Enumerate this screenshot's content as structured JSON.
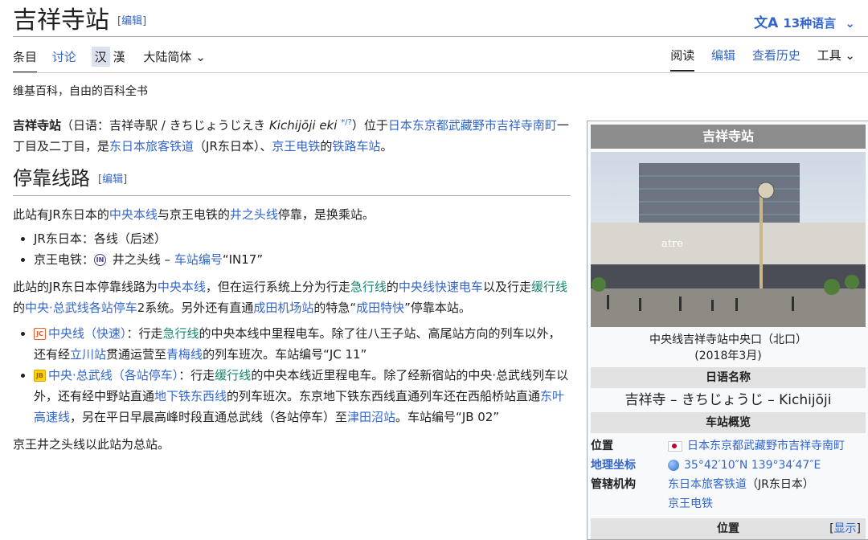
{
  "page": {
    "title": "吉祥寺站",
    "edit_label": "编辑",
    "languages_label": "13种语言",
    "tagline": "维基百科，自由的百科全书"
  },
  "tabs": {
    "left": [
      "条目",
      "讨论"
    ],
    "variants": [
      "汉",
      "漢"
    ],
    "variant_dropdown": "大陆简体",
    "right": [
      "阅读",
      "编辑",
      "查看历史",
      "工具"
    ]
  },
  "intro": {
    "lead_bold": "吉祥寺站",
    "lead_text1": "（日语：吉祥寺駅 / きちじょうじえき",
    "romaji": "Kichijōji eki",
    "audio_marks": "*/?",
    "lead_text2": "）位于",
    "loc_link": "日本东京都武藏野市吉祥寺南町",
    "lead_text3": "一丁目及二丁目，是",
    "jr_link": "东日本旅客铁道",
    "lead_text4": "（JR东日本）、",
    "keio_link": "京王电铁",
    "lead_text5": "的",
    "station_link": "铁路车站",
    "lead_text6": "。"
  },
  "section": {
    "heading": "停靠线路",
    "edit_label": "编辑",
    "p1": {
      "t1": "此站有JR东日本的",
      "l1": "中央本线",
      "t2": "与京王电铁的",
      "l2": "井之头线",
      "t3": "停靠，是换乘站。"
    },
    "bullets1": [
      {
        "text": "JR东日本：各线（后述）"
      },
      {
        "t1": "京王电铁：",
        "badge": "IN",
        "t2": " 井之头线 – ",
        "link": "车站编号",
        "t3": "“IN17”"
      }
    ],
    "p2": {
      "t1": "此站的JR东日本停靠线路为",
      "l1": "中央本线",
      "t2": "，但在运行系统上分为行走",
      "l2": "急行线",
      "t3": "的",
      "l3": "中央线快速电车",
      "t4": "以及行走",
      "l4": "缓行线",
      "t5": "的",
      "l5": "中央·总武线各站停车",
      "t6": "2系统。另外还有直通",
      "l6": "成田机场站",
      "t7": "的特急“",
      "l7": "成田特快",
      "t8": "”停靠本站。"
    },
    "bullets2": [
      {
        "badge": "JC",
        "name": "中央线（快速）",
        "t1": "：行走",
        "l1": "急行线",
        "t2": "的中央本线中里程电车。除了往八王子站、高尾站方向的列车以外，还有经",
        "l2": "立川站",
        "t3": "贯通运营至",
        "l3": "青梅线",
        "t4": "的列车班次。车站编号“JC 11”"
      },
      {
        "badge": "JB",
        "name": "中央·总武线（各站停车）",
        "t1": "：行走",
        "l1": "缓行线",
        "t2": "的中央本线近里程电车。除了经新宿站的中央·总武线列车以外，还有经中野站直通",
        "l2": "地下铁东西线",
        "t3": "的列车班次。东京地下铁东西线直通列车还在西船桥站直通",
        "l3": "东叶高速线",
        "t4": "，另在平日早晨高峰时段直通总武线（各站停车）至",
        "l4": "津田沼站",
        "t5": "。车站编号“JB 02”"
      }
    ],
    "p3": "京王井之头线以此站为总站。"
  },
  "infobox": {
    "title": "吉祥寺站",
    "photo_sign": "atre",
    "caption_line1": "中央线吉祥寺站中央口（北口）",
    "caption_line2": "(2018年3月)",
    "jp_name_header": "日语名称",
    "jp_name": "吉祥寺 – きちじょうじ – Kichijōji",
    "overview_header": "车站概览",
    "rows": [
      {
        "key": "位置",
        "value": "日本东京都武藏野市吉祥寺南町"
      },
      {
        "key": "地理坐标",
        "value": "35°42′10″N 139°34′47″E"
      },
      {
        "key": "管辖机构",
        "value": "东日本旅客铁道",
        "value_suffix": "（JR东日本）",
        "value2": "京王电铁"
      }
    ],
    "location_header": "位置",
    "show_label": "显示"
  }
}
